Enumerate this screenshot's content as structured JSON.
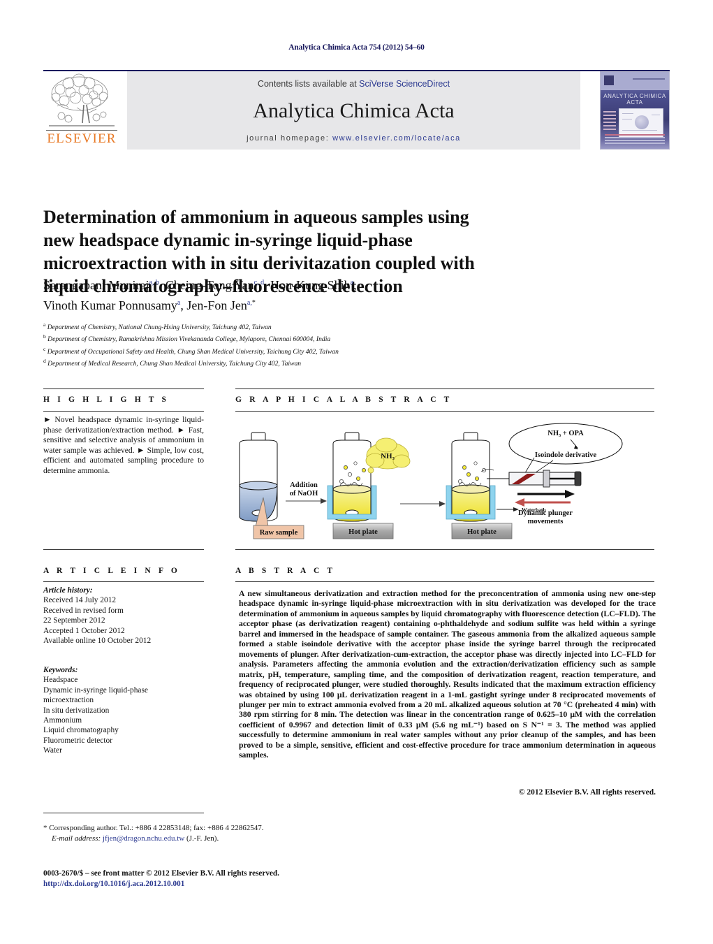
{
  "running_head": "Analytica Chimica Acta 754 (2012) 54–60",
  "masthead": {
    "publisher_name": "ELSEVIER",
    "contents_prefix": "Contents lists available at ",
    "contents_link": "SciVerse ScienceDirect",
    "journal_name": "Analytica Chimica Acta",
    "homepage_prefix": "journal homepage: ",
    "homepage_url": "www.elsevier.com/locate/aca",
    "cover_title": "ANALYTICA CHIMICA ACTA",
    "link_color": "#2b3990",
    "band_color": "#e7e7e9",
    "elsevier_orange": "#e87722"
  },
  "article": {
    "title": "Determination of ammonium in aqueous samples using new headspace dynamic in-syringe liquid-phase microextraction with in situ derivitazation coupled with liquid chromatography–fluorescence detection",
    "authors_line_1": "Sarangapani Muniraj",
    "authors_line_1_sup": "a, b",
    "authors_2": "Cheing-Tong Yan",
    "authors_2_sup": "c, d",
    "authors_3": "Hou-Kung Shih",
    "authors_3_sup": "a",
    "authors_4": "Vinoth Kumar Ponnusamy",
    "authors_4_sup": "a",
    "authors_5": "Jen-Fon Jen",
    "authors_5_sup": "a,",
    "affiliations": [
      {
        "mark": "a",
        "text": "Department of Chemistry, National Chung-Hsing University, Taichung 402, Taiwan"
      },
      {
        "mark": "b",
        "text": "Department of Chemistry, Ramakrishna Mission Vivekananda College, Mylapore, Chennai 600004, India"
      },
      {
        "mark": "c",
        "text": "Department of Occupational Safety and Health, Chung Shan Medical University, Taichung City 402, Taiwan"
      },
      {
        "mark": "d",
        "text": "Department of Medical Research, Chung Shan Medical University, Taichung City 402, Taiwan"
      }
    ]
  },
  "highlights": {
    "heading": "H I G H L I G H T S",
    "text": "► Novel headspace dynamic in-syringe liquid-phase derivatization/extraction method. ► Fast, sensitive and selective analysis of ammonium in water sample was achieved. ► Simple, low cost, efficient and automated sampling procedure to determine ammonia."
  },
  "graphical_abstract": {
    "heading": "G R A P H I C A L   A B S T R A C T",
    "labels": {
      "raw_sample": "Raw sample",
      "addition_naoh_line1": "Addition",
      "addition_naoh_line2": "of NaOH",
      "nh3_cloud": "NH₃",
      "hot_plate_1": "Hot plate",
      "hot_plate_2": "Hot plate",
      "reaction_line1": "NH₃ + OPA",
      "reaction_line2": "Isoindole derivative",
      "plunger_line1": "Dynamic plunger",
      "plunger_line2": "movements",
      "water_bath": "Waterbath"
    },
    "colors": {
      "raw_sample_box": "#f0c5a8",
      "liquid_blue": "#b8c8e0",
      "liquid_yellow": "#f2e735",
      "water_bath_blue": "#8fd4ee",
      "hot_plate_gray": "#b0b0b0",
      "cloud_yellow": "#f5ef72",
      "arrow_red": "#c0504d"
    }
  },
  "article_info": {
    "heading": "A R T I C L E   I N F O",
    "history_label": "Article history:",
    "history": [
      "Received 14 July 2012",
      "Received in revised form",
      "22 September 2012",
      "Accepted 1 October 2012",
      "Available online 10 October 2012"
    ],
    "keywords_label": "Keywords:",
    "keywords": [
      "Headspace",
      "Dynamic in-syringe liquid-phase",
      "microextraction",
      "In situ derivatization",
      "Ammonium",
      "Liquid chromatography",
      "Fluorometric detector",
      "Water"
    ]
  },
  "abstract": {
    "heading": "A B S T R A C T",
    "text": "A new simultaneous derivatization and extraction method for the preconcentration of ammonia using new one-step headspace dynamic in-syringe liquid-phase microextraction with in situ derivatization was developed for the trace determination of ammonium in aqueous samples by liquid chromatography with fluorescence detection (LC–FLD). The acceptor phase (as derivatization reagent) containing o-phthaldehyde and sodium sulfite was held within a syringe barrel and immersed in the headspace of sample container. The gaseous ammonia from the alkalized aqueous sample formed a stable isoindole derivative with the acceptor phase inside the syringe barrel through the reciprocated movements of plunger. After derivatization-cum-extraction, the acceptor phase was directly injected into LC–FLD for analysis. Parameters affecting the ammonia evolution and the extraction/derivatization efficiency such as sample matrix, pH, temperature, sampling time, and the composition of derivatization reagent, reaction temperature, and frequency of reciprocated plunger, were studied thoroughly. Results indicated that the maximum extraction efficiency was obtained by using 100 μL derivatization reagent in a 1-mL gastight syringe under 8 reciprocated movements of plunger per min to extract ammonia evolved from a 20 mL alkalized aqueous solution at 70 °C (preheated 4 min) with 380 rpm stirring for 8 min. The detection was linear in the concentration range of 0.625–10 μM with the correlation coefficient of 0.9967 and detection limit of 0.33 μM (5.6 ng mL⁻¹) based on S N⁻¹ = 3. The method was applied successfully to determine ammonium in real water samples without any prior cleanup of the samples, and has been proved to be a simple, sensitive, efficient and cost-effective procedure for trace ammonium determination in aqueous samples.",
    "copyright": "© 2012 Elsevier B.V. All rights reserved."
  },
  "footnotes": {
    "corresponding_star": "*",
    "corresponding_text": "Corresponding author. Tel.: +886 4 22853148; fax: +886 4 22862547.",
    "email_label": "E-mail address:",
    "email_address": "jfjen@dragon.nchu.edu.tw",
    "email_suffix": "(J.-F. Jen).",
    "issn_line": "0003-2670/$ – see front matter © 2012 Elsevier B.V. All rights reserved.",
    "doi": "http://dx.doi.org/10.1016/j.aca.2012.10.001"
  }
}
